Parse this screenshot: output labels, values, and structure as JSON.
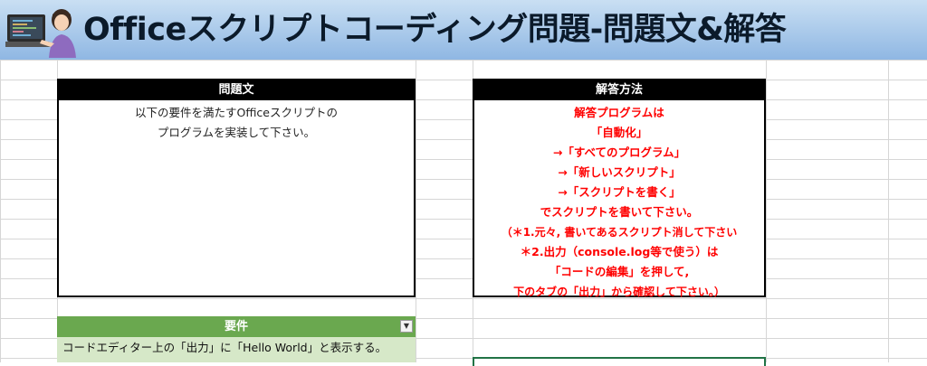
{
  "banner": {
    "title": "Officeスクリプトコーディング問題-問題文&解答"
  },
  "question_panel": {
    "header": "問題文",
    "lines": [
      "以下の要件を満たすOfficeスクリプトの",
      "プログラムを実装して下さい。"
    ]
  },
  "answer_panel": {
    "header": "解答方法",
    "lines": [
      "解答プログラムは",
      "「自動化」",
      "→「すべてのプログラム」",
      "→「新しいスクリプト」",
      "→「スクリプトを書く」",
      "でスクリプトを書いて下さい。",
      "（＊1.元々, 書いてあるスクリプト消して下さい",
      "＊2.出力（console.log等で使う）は",
      "「コードの編集」を押して,",
      "下のタブの「出力」から確認して下さい。）"
    ],
    "text_color": "#ff0000"
  },
  "requirements": {
    "header": "要件",
    "filter_icon": "dropdown-filter-icon",
    "rows": [
      "コードエディター上の「出力」に「Hello World」と表示する。"
    ],
    "header_color": "#6aa84f",
    "row_color": "#d6e8c8"
  }
}
